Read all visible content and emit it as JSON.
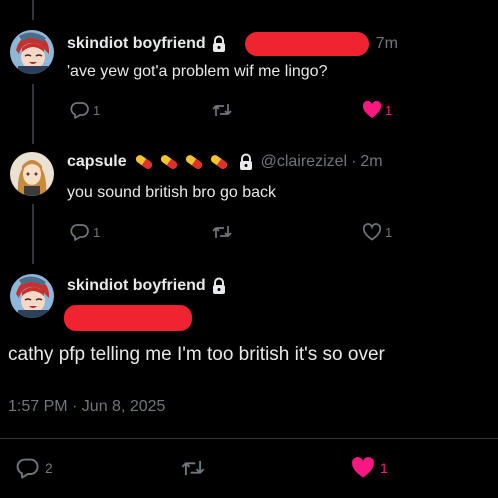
{
  "thread": [
    {
      "author": "skindiot boyfriend",
      "time": "7m",
      "text": "'ave yew got'a problem wif me lingo?",
      "replies": "1",
      "likes": "1"
    },
    {
      "author": "capsule",
      "emoji": [
        "pill-emoji",
        "pill-emoji",
        "pill-emoji",
        "pill-emoji"
      ],
      "handle": "@clairezizel",
      "separator": "·",
      "time": "2m",
      "text": "you sound british bro go back",
      "replies": "1",
      "likes": "1"
    }
  ],
  "main_post": {
    "author": "skindiot boyfriend",
    "text": "cathy pfp telling me I'm too british it's so over",
    "timestamp": "1:57 PM · Jun 8, 2025",
    "replies": "2",
    "likes": "1"
  },
  "colors": {
    "background": "#000000",
    "text": "#e7e9ea",
    "muted": "#71767b",
    "like": "#f91880",
    "redaction": "#f02430",
    "divider": "#2f3336"
  }
}
